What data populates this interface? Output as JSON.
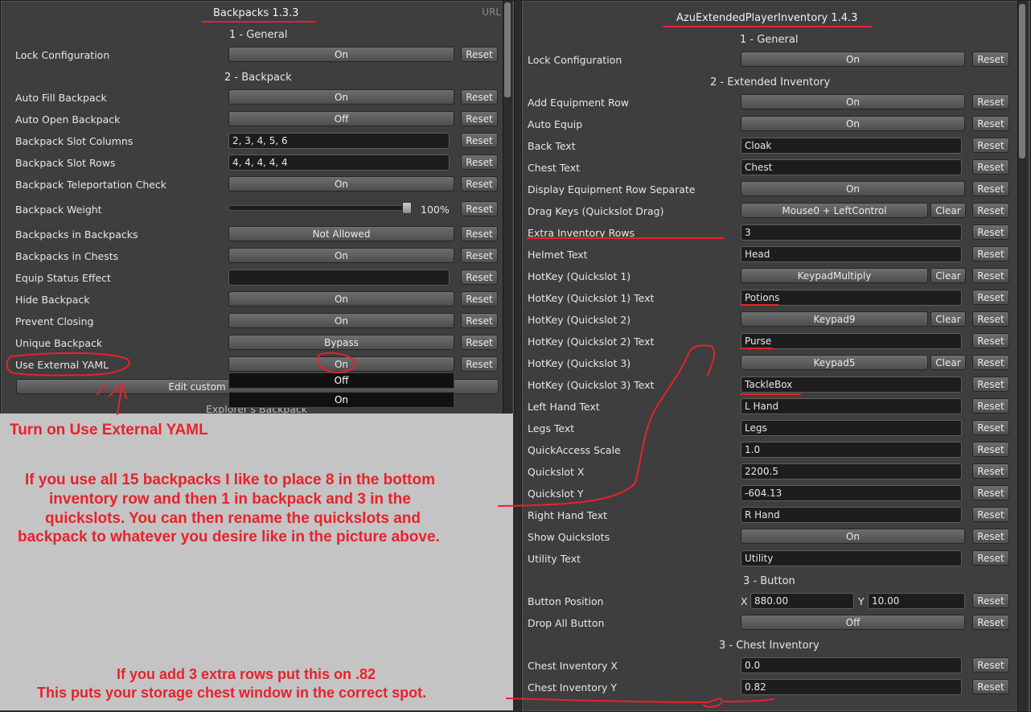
{
  "left_panel": {
    "title": "Backpacks 1.3.3",
    "url": "URL",
    "sections": {
      "general": "1 - General",
      "backpack": "2 - Backpack",
      "explorer": "Explorer's Backpack"
    },
    "rows": [
      {
        "label": "Lock Configuration",
        "type": "button",
        "value": "On"
      },
      {
        "label": "Auto Fill Backpack",
        "type": "button",
        "value": "On"
      },
      {
        "label": "Auto Open Backpack",
        "type": "button",
        "value": "Off"
      },
      {
        "label": "Backpack Slot Columns",
        "type": "input",
        "value": "2, 3, 4, 5, 6"
      },
      {
        "label": "Backpack Slot Rows",
        "type": "input",
        "value": "4, 4, 4, 4, 4"
      },
      {
        "label": "Backpack Teleportation Check",
        "type": "button",
        "value": "On"
      },
      {
        "label": "Backpack Weight",
        "type": "slider",
        "value": "100%",
        "level": 1.0
      },
      {
        "label": "Backpacks in Backpacks",
        "type": "button",
        "value": "Not Allowed"
      },
      {
        "label": "Backpacks in Chests",
        "type": "button",
        "value": "On"
      },
      {
        "label": "Equip Status Effect",
        "type": "input",
        "value": ""
      },
      {
        "label": "Hide Backpack",
        "type": "button",
        "value": "On"
      },
      {
        "label": "Prevent Closing",
        "type": "button",
        "value": "On"
      },
      {
        "label": "Unique Backpack",
        "type": "button",
        "value": "Bypass"
      },
      {
        "label": "Use External YAML",
        "type": "button",
        "value": "On"
      }
    ],
    "reset_label": "Reset",
    "edit_custom_label": "Edit custom",
    "dropdown_options": [
      "Off",
      "On"
    ]
  },
  "right_panel": {
    "title": "AzuExtendedPlayerInventory 1.4.3",
    "sections": {
      "general": "1 - General",
      "extended": "2 - Extended Inventory",
      "button": "3 - Button",
      "chest": "3 - Chest Inventory"
    },
    "reset_label": "Reset",
    "clear_label": "Clear",
    "rows": [
      {
        "label": "Lock Configuration",
        "type": "button",
        "value": "On"
      },
      {
        "label": "Add Equipment Row",
        "type": "button",
        "value": "On"
      },
      {
        "label": "Auto Equip",
        "type": "button",
        "value": "On"
      },
      {
        "label": "Back Text",
        "type": "input",
        "value": "Cloak"
      },
      {
        "label": "Chest Text",
        "type": "input",
        "value": "Chest"
      },
      {
        "label": "Display Equipment Row Separate",
        "type": "button",
        "value": "On"
      },
      {
        "label": "Drag Keys (Quickslot Drag)",
        "type": "key",
        "value": "Mouse0 + LeftControl"
      },
      {
        "label": "Extra Inventory Rows",
        "type": "input",
        "value": "3"
      },
      {
        "label": "Helmet Text",
        "type": "input",
        "value": "Head"
      },
      {
        "label": "HotKey (Quickslot 1)",
        "type": "key",
        "value": "KeypadMultiply"
      },
      {
        "label": "HotKey (Quickslot 1) Text",
        "type": "input",
        "value": "Potions"
      },
      {
        "label": "HotKey (Quickslot 2)",
        "type": "key",
        "value": "Keypad9"
      },
      {
        "label": "HotKey (Quickslot 2) Text",
        "type": "input",
        "value": "Purse"
      },
      {
        "label": "HotKey (Quickslot 3)",
        "type": "key",
        "value": "Keypad5"
      },
      {
        "label": "HotKey (Quickslot 3) Text",
        "type": "input",
        "value": "TackleBox"
      },
      {
        "label": "Left Hand Text",
        "type": "input",
        "value": "L Hand"
      },
      {
        "label": "Legs Text",
        "type": "input",
        "value": "Legs"
      },
      {
        "label": "QuickAccess Scale",
        "type": "input",
        "value": "1.0"
      },
      {
        "label": "Quickslot X",
        "type": "input",
        "value": "2200.5"
      },
      {
        "label": "Quickslot Y",
        "type": "input",
        "value": "-604.13"
      },
      {
        "label": "Right Hand Text",
        "type": "input",
        "value": "R Hand"
      },
      {
        "label": "Show Quickslots",
        "type": "button",
        "value": "On"
      },
      {
        "label": "Utility Text",
        "type": "input",
        "value": "Utility"
      },
      {
        "label": "Button Position",
        "type": "xy",
        "x_label": "X",
        "x_value": "880.00",
        "y_label": "Y",
        "y_value": "10.00"
      },
      {
        "label": "Drop All Button",
        "type": "button",
        "value": "Off"
      },
      {
        "label": "Chest Inventory X",
        "type": "input",
        "value": "0.0"
      },
      {
        "label": "Chest Inventory Y",
        "type": "input",
        "value": "0.82"
      }
    ]
  },
  "annotations": {
    "turn_on": "Turn on Use External YAML",
    "tip_lines": [
      "If you use all 15 backpacks I like to place 8 in the bottom",
      "inventory row and then 1 in  backpack and 3 in the",
      "quickslots. You can then rename the quickslots and",
      "backpack to whatever you desire like in the picture above."
    ],
    "chest_lines": [
      "If you add 3 extra rows put this on .82",
      "This puts your storage chest window in the  correct spot."
    ],
    "color": "#e8222b"
  }
}
